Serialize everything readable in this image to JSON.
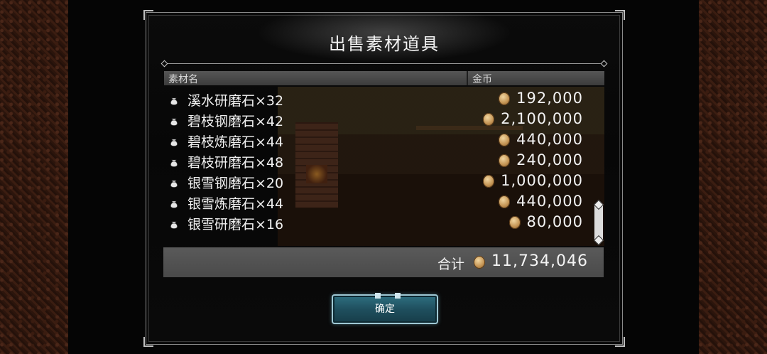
{
  "dialog": {
    "title": "出售素材道具",
    "columns": {
      "name": "素材名",
      "gold": "金币"
    },
    "items": [
      {
        "name": "溪水研磨石×32",
        "price": "192,000"
      },
      {
        "name": "碧枝钢磨石×42",
        "price": "2,100,000"
      },
      {
        "name": "碧枝炼磨石×44",
        "price": "440,000"
      },
      {
        "name": "碧枝研磨石×48",
        "price": "240,000"
      },
      {
        "name": "银雪钢磨石×20",
        "price": "1,000,000"
      },
      {
        "name": "银雪炼磨石×44",
        "price": "440,000"
      },
      {
        "name": "银雪研磨石×16",
        "price": "80,000"
      }
    ],
    "total_label": "合计",
    "total_value": "11,734,046",
    "confirm_label": "确定"
  },
  "icons": {
    "item": "pouch-icon",
    "currency": "gold-coin-icon"
  },
  "colors": {
    "panel_bg": "#0a0a0a",
    "confirm_button": "#1f4f5e",
    "coin": "#c49454"
  }
}
